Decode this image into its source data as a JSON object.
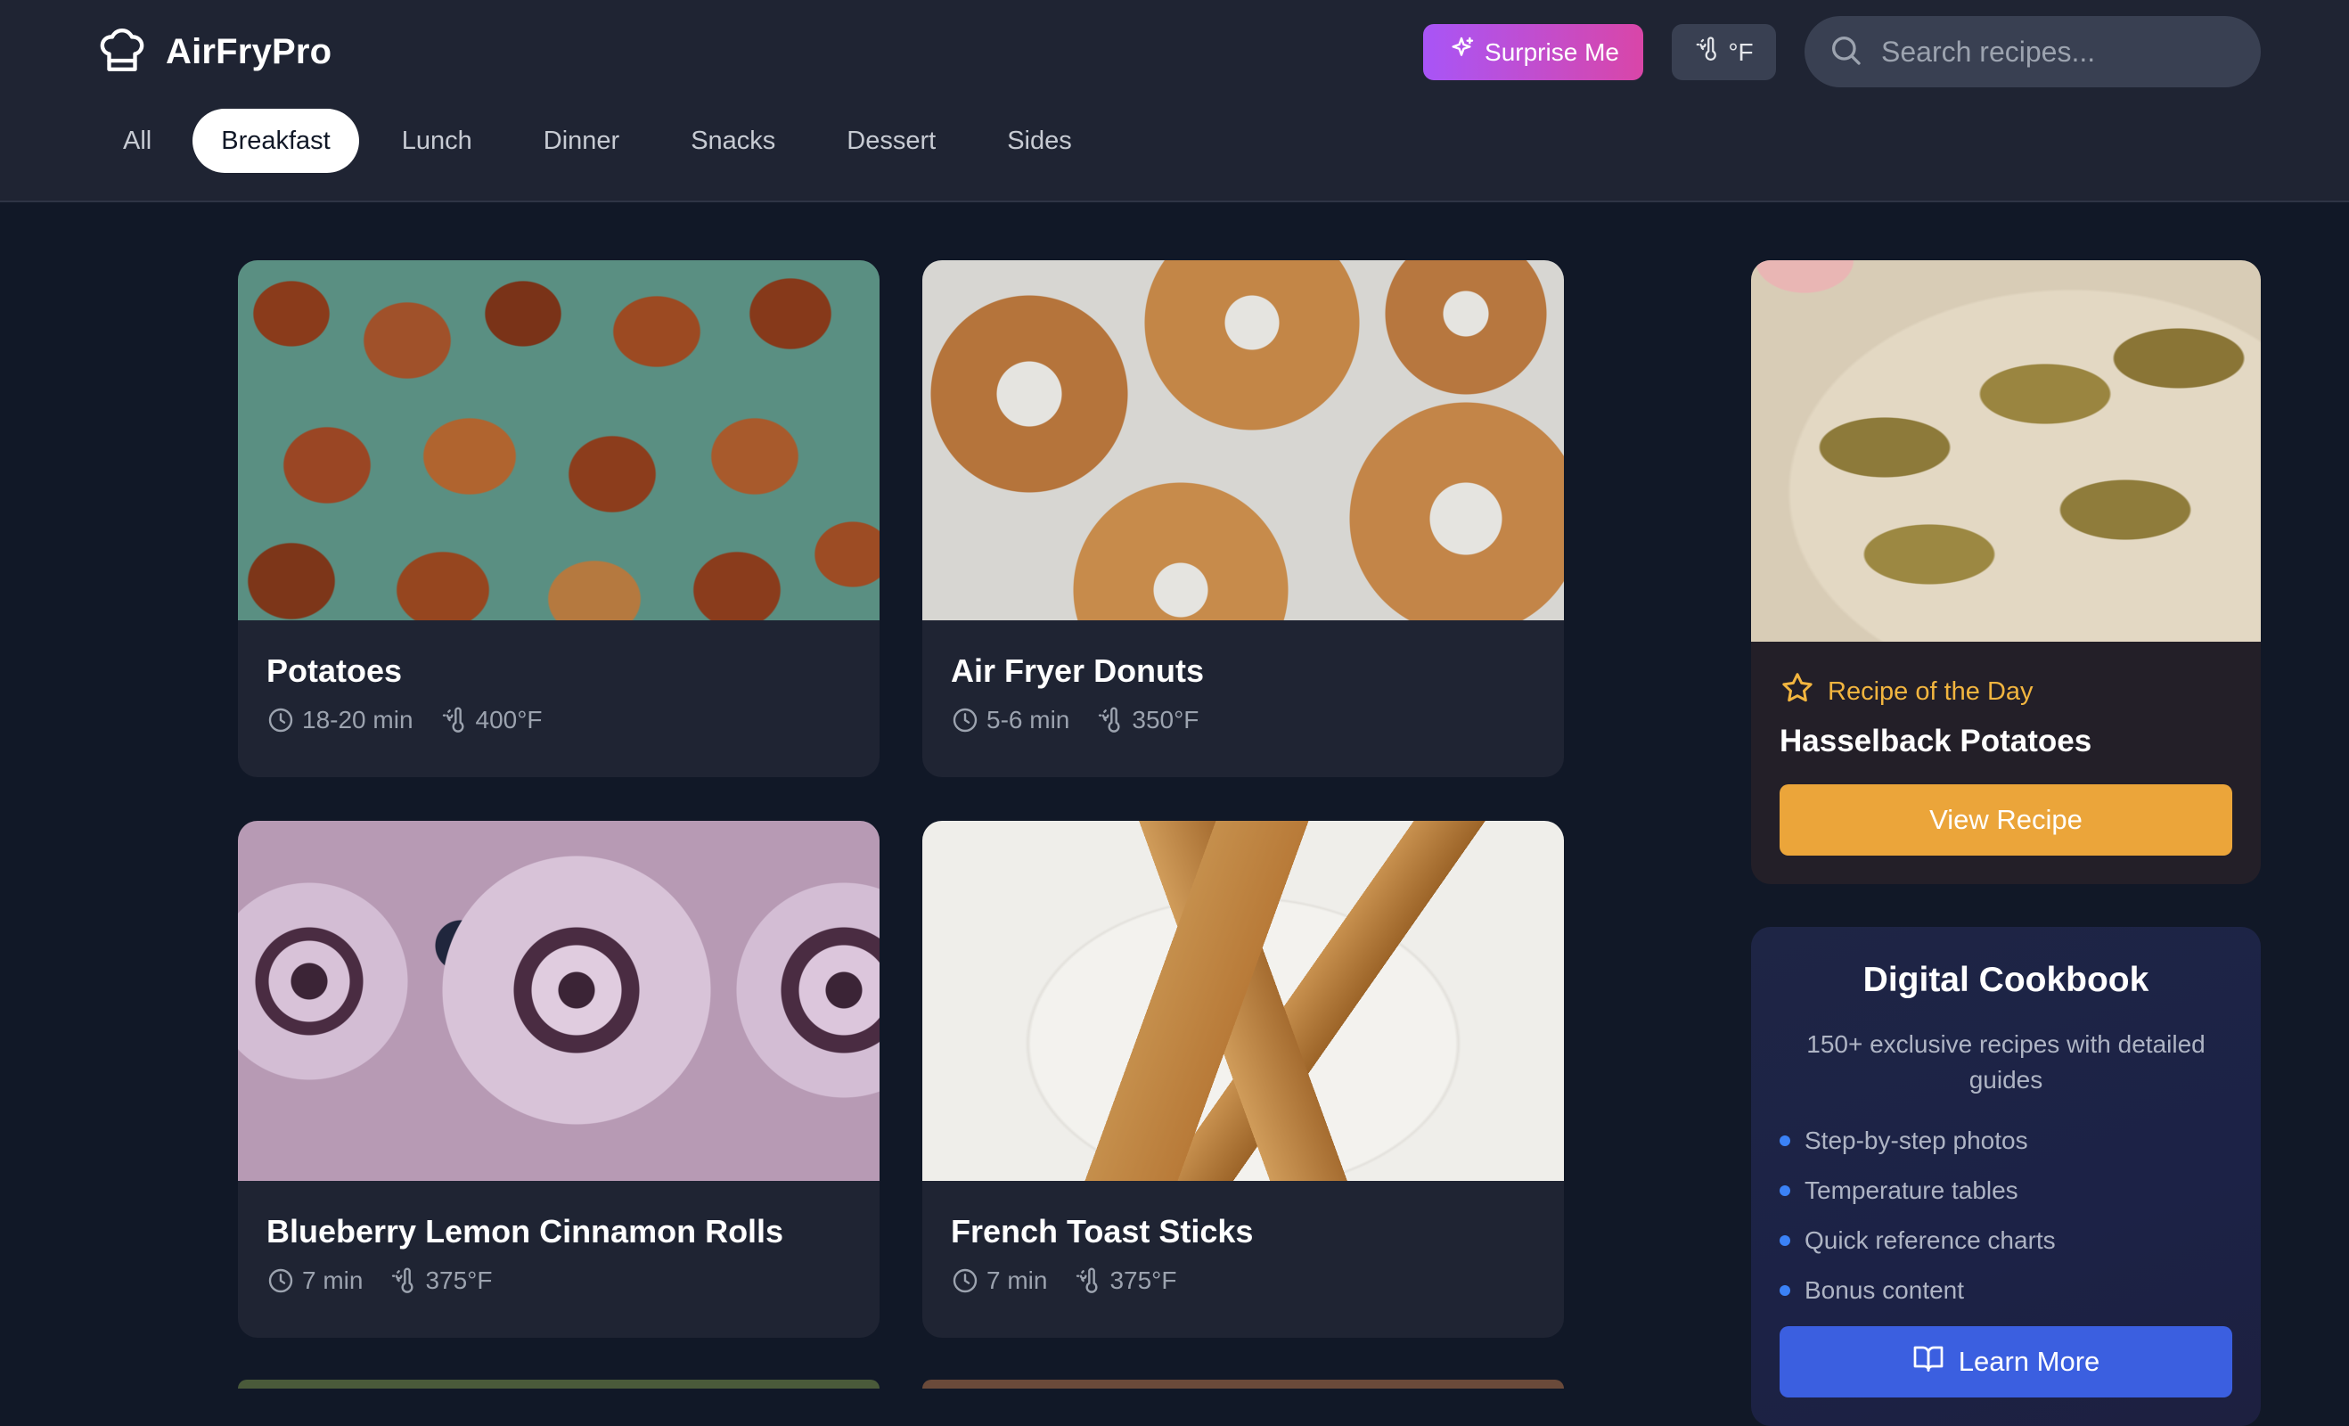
{
  "app": {
    "name": "AirFryPro"
  },
  "header": {
    "surprise_label": "Surprise Me",
    "unit_label": "°F",
    "search_placeholder": "Search recipes..."
  },
  "tabs": [
    {
      "label": "All",
      "active": false
    },
    {
      "label": "Breakfast",
      "active": true
    },
    {
      "label": "Lunch",
      "active": false
    },
    {
      "label": "Dinner",
      "active": false
    },
    {
      "label": "Snacks",
      "active": false
    },
    {
      "label": "Dessert",
      "active": false
    },
    {
      "label": "Sides",
      "active": false
    }
  ],
  "recipes": [
    {
      "title": "Potatoes",
      "time": "18-20 min",
      "temp": "400°F"
    },
    {
      "title": "Air Fryer Donuts",
      "time": "5-6 min",
      "temp": "350°F"
    },
    {
      "title": "Blueberry Lemon Cinnamon Rolls",
      "time": "7 min",
      "temp": "375°F"
    },
    {
      "title": "French Toast Sticks",
      "time": "7 min",
      "temp": "375°F"
    }
  ],
  "recipe_of_the_day": {
    "label": "Recipe of the Day",
    "title": "Hasselback Potatoes",
    "button": "View Recipe"
  },
  "cookbook": {
    "title": "Digital Cookbook",
    "description": "150+ exclusive recipes with detailed guides",
    "features": [
      "Step-by-step photos",
      "Temperature tables",
      "Quick reference charts",
      "Bonus content"
    ],
    "button": "Learn More"
  },
  "colors": {
    "background": "#111827",
    "header": "#1f2433",
    "accent_orange": "#eba53a",
    "accent_blue": "#3b5fe0",
    "surprise_gradient_start": "#a855f7",
    "surprise_gradient_end": "#d946a8"
  },
  "icons": {
    "logo": "chef-hat-icon",
    "surprise": "sparkles-icon",
    "unit": "thermometer-icon",
    "search": "search-icon",
    "time": "clock-icon",
    "temp": "thermometer-icon",
    "rotd": "star-icon",
    "learn": "book-open-icon"
  }
}
